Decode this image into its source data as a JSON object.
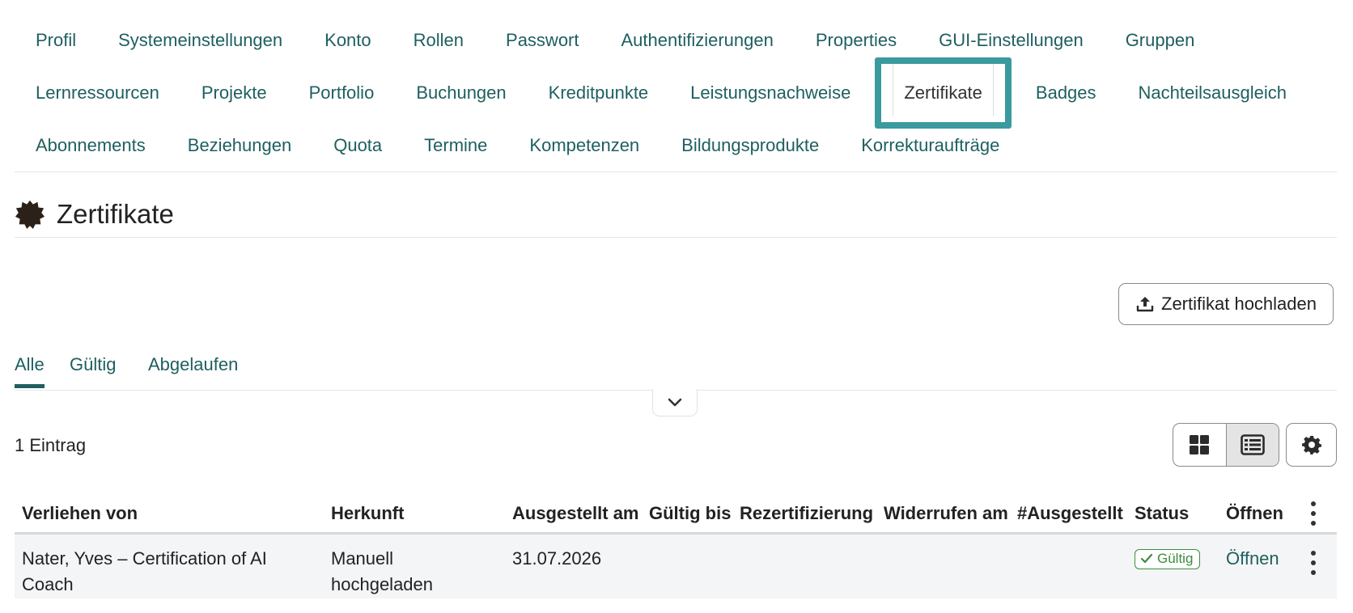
{
  "nav": {
    "rows": [
      [
        "Profil",
        "Systemeinstellungen",
        "Konto",
        "Rollen",
        "Passwort",
        "Authentifizierungen",
        "Properties",
        "GUI-Einstellungen",
        "Gruppen"
      ],
      [
        "Lernressourcen",
        "Projekte",
        "Portfolio",
        "Buchungen",
        "Kreditpunkte",
        "Leistungsnachweise",
        "Zertifikate",
        "Badges",
        "Nachteilsausgleich"
      ],
      [
        "Abonnements",
        "Beziehungen",
        "Quota",
        "Termine",
        "Kompetenzen",
        "Bildungsprodukte",
        "Korrekturaufträge"
      ]
    ],
    "active": "Zertifikate",
    "accent_color": "#3a9a9d",
    "link_color": "#1f5f60"
  },
  "page": {
    "title": "Zertifikate",
    "title_icon": "certificate-seal-icon"
  },
  "toolbar": {
    "upload_label": "Zertifikat hochladen",
    "upload_icon": "upload-icon"
  },
  "filters": {
    "tabs": [
      "Alle",
      "Gültig",
      "Abgelaufen"
    ],
    "active": "Alle"
  },
  "table": {
    "count_label": "1 Eintrag",
    "columns": [
      "Verliehen von",
      "Herkunft",
      "Ausgestellt am",
      "Gültig bis",
      "Rezertifizierung",
      "Widerrufen am",
      "#Ausgestellt",
      "Status",
      "Öffnen"
    ],
    "rows": [
      {
        "verliehen_von": "Nater, Yves – Certification of AI Coach",
        "herkunft": "Manuell hochgeladen",
        "ausgestellt_am": "31.07.2026",
        "gueltig_bis": "",
        "rezertifizierung": "",
        "widerrufen_am": "",
        "ausgestellt_count": "",
        "status": "Gültig",
        "status_color": "#3d8c3d",
        "open_label": "Öffnen"
      }
    ]
  },
  "view": {
    "modes": [
      "grid",
      "list"
    ],
    "selected": "list"
  }
}
